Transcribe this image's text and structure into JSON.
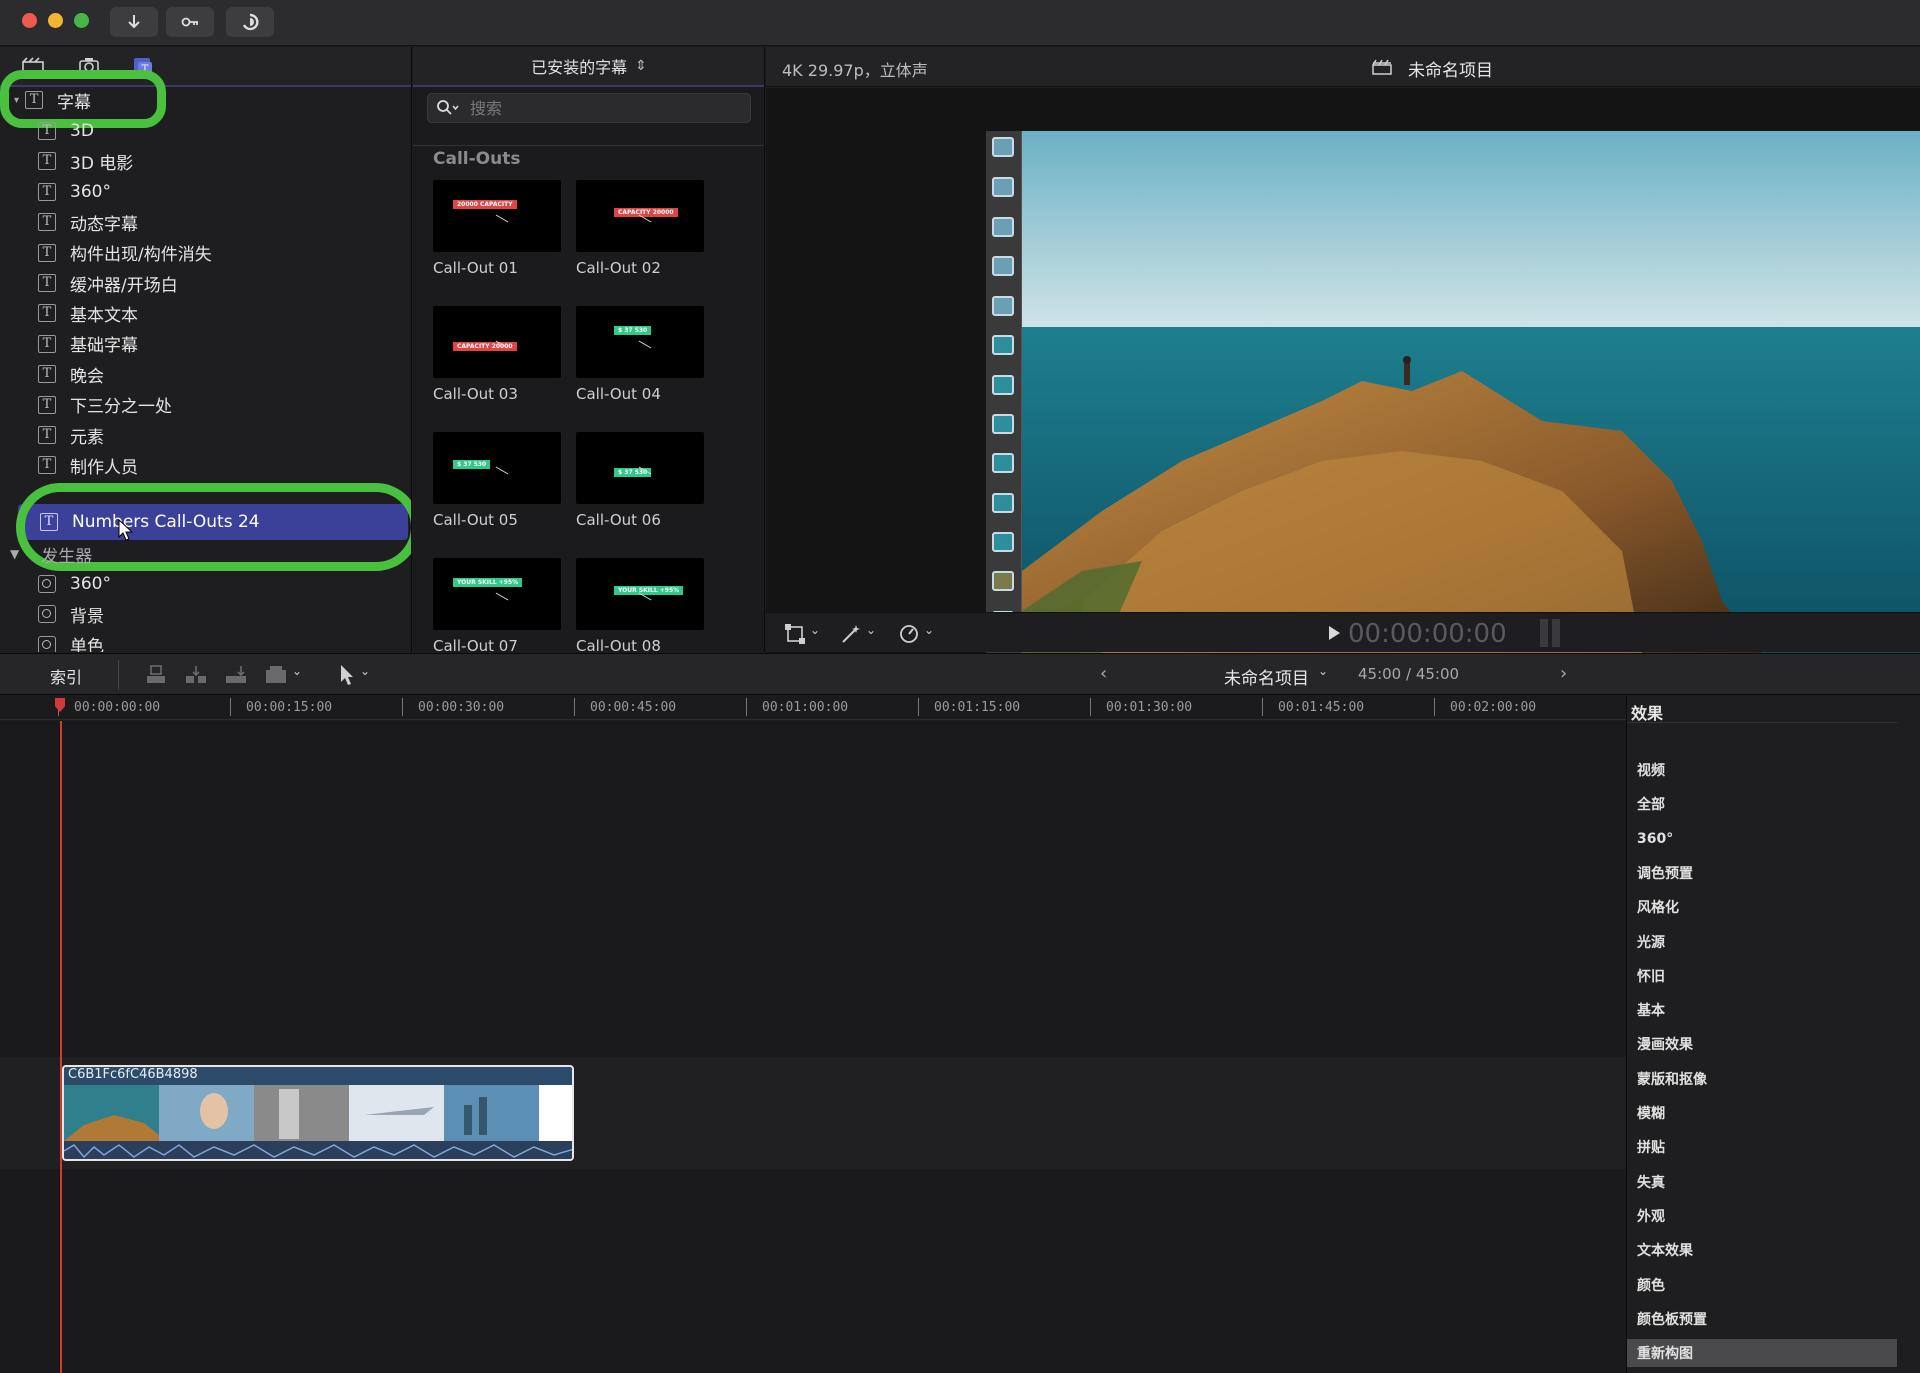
{
  "titlebar": {
    "buttons": [
      "import-icon",
      "keyword-icon",
      "background-tasks-icon"
    ]
  },
  "sidebar": {
    "tab_icons": [
      "libraries-icon",
      "photos-audio-icon",
      "titles-generators-icon"
    ],
    "selected_category": "字幕",
    "items": [
      {
        "label": "3D"
      },
      {
        "label": "3D 电影"
      },
      {
        "label": "360°"
      },
      {
        "label": "动态字幕"
      },
      {
        "label": "构件出现/构件消失"
      },
      {
        "label": "缓冲器/开场白"
      },
      {
        "label": "基本文本"
      },
      {
        "label": "基础字幕"
      },
      {
        "label": "晚会"
      },
      {
        "label": "下三分之一处"
      },
      {
        "label": "元素"
      },
      {
        "label": "制作人员"
      }
    ],
    "highlighted_item": "Numbers Call-Outs 24",
    "generators_label": "发生器",
    "generator_items": [
      {
        "label": "360°"
      },
      {
        "label": "背景"
      },
      {
        "label": "单色"
      }
    ]
  },
  "browser": {
    "header": "已安装的字幕",
    "search_placeholder": "搜索",
    "section_title": "Call-Outs",
    "thumbs": [
      {
        "label": "Call-Out 01",
        "tag": "20000 CAPACITY"
      },
      {
        "label": "Call-Out 02",
        "tag": "CAPACITY 20000"
      },
      {
        "label": "Call-Out 03",
        "tag": "CAPACITY 20000"
      },
      {
        "label": "Call-Out 04",
        "tag": "$ 37 530"
      },
      {
        "label": "Call-Out 05",
        "tag": "$ 37 530"
      },
      {
        "label": "Call-Out 06",
        "tag": "$ 37 530"
      },
      {
        "label": "Call-Out 07",
        "tag": "YOUR SKILL +95%"
      },
      {
        "label": "Call-Out 08",
        "tag": "YOUR SKILL +95%"
      }
    ]
  },
  "viewer": {
    "format": "4K 29.97p，立体声",
    "project_title": "未命名项目",
    "timecode": "00:00:00:00"
  },
  "timeline_toolbar": {
    "index_label": "索引",
    "project_name": "未命名项目",
    "duration": "45:00 / 45:00"
  },
  "ruler": {
    "ticks": [
      "00:00:00:00",
      "00:00:15:00",
      "00:00:30:00",
      "00:00:45:00",
      "00:01:00:00",
      "00:01:15:00",
      "00:01:30:00",
      "00:01:45:00",
      "00:02:00:00"
    ]
  },
  "timeline": {
    "clip_name": "C6B1Fc6fC46B4898"
  },
  "effects": {
    "title": "效果",
    "items": [
      "视频",
      "全部",
      "360°",
      "调色预置",
      "风格化",
      "光源",
      "怀旧",
      "基本",
      "漫画效果",
      "蒙版和抠像",
      "模糊",
      "拼贴",
      "失真",
      "外观",
      "文本效果",
      "颜色",
      "颜色板预置",
      "重新构图"
    ],
    "selected": "重新构图"
  },
  "colors": {
    "accent_highlight": "#3b4199",
    "annotation_ring": "#4ac13e",
    "playhead": "#d23a3a"
  }
}
